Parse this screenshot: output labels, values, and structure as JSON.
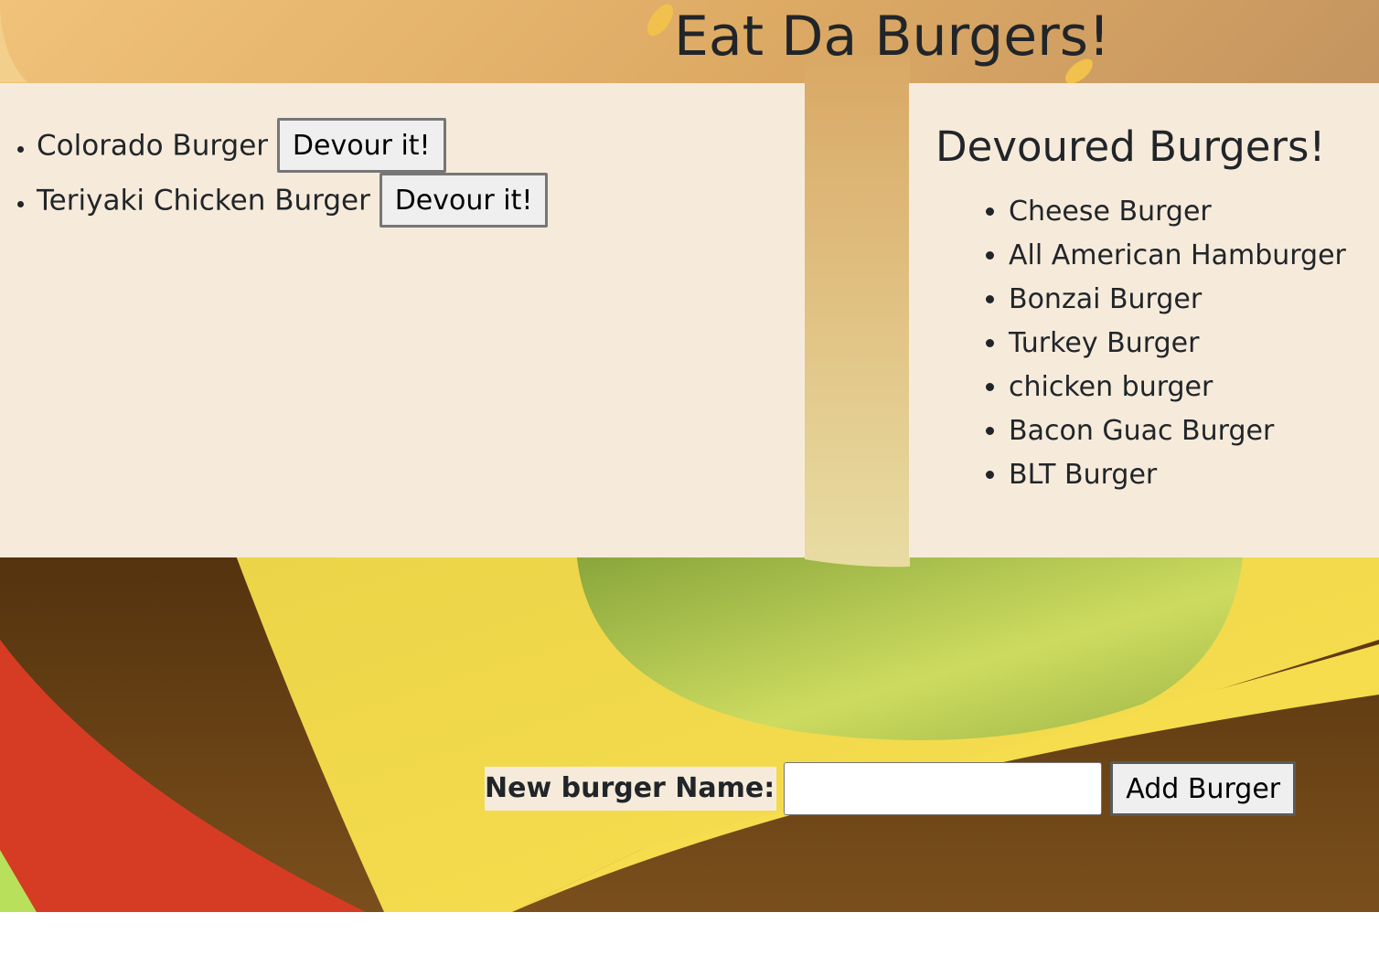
{
  "header": {
    "title": "Eat Da Burgers!"
  },
  "uneaten": {
    "items": [
      {
        "name": "Colorado Burger",
        "button_label": "Devour it!"
      },
      {
        "name": "Teriyaki Chicken Burger",
        "button_label": "Devour it!"
      }
    ]
  },
  "devoured": {
    "heading": "Devoured Burgers!",
    "items": [
      "Cheese Burger",
      "All American Hamburger",
      "Bonzai Burger",
      "Turkey Burger",
      "chicken burger",
      "Bacon Guac Burger",
      "BLT Burger"
    ]
  },
  "form": {
    "label": "New burger Name:",
    "input_value": "",
    "submit_label": "Add Burger"
  },
  "colors": {
    "panel_background": "#f6ebdb",
    "bun": "#e7b46a",
    "cheese": "#f3d94a",
    "lettuce": "#a8c04a",
    "patty": "#5e3a12",
    "tomato": "#d8402a"
  }
}
